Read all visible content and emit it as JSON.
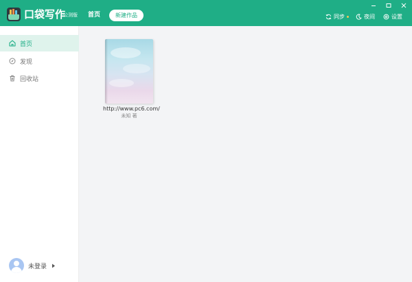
{
  "header": {
    "app_name": "口袋写作",
    "edition": "公测版",
    "nav_home": "首页",
    "new_work_button": "新建作品",
    "sync": "同步",
    "night_mode": "夜间",
    "settings": "设置"
  },
  "sidebar": {
    "items": [
      {
        "label": "首页",
        "icon": "home-icon",
        "active": true
      },
      {
        "label": "发现",
        "icon": "compass-icon",
        "active": false
      },
      {
        "label": "回收站",
        "icon": "trash-icon",
        "active": false
      }
    ],
    "user": {
      "name": "未登录",
      "icon": "avatar"
    }
  },
  "works": [
    {
      "title": "http://www.pc6.com/",
      "author": "未知 著"
    }
  ],
  "colors": {
    "accent": "#1fae86",
    "active_bg": "#dff3ec"
  }
}
